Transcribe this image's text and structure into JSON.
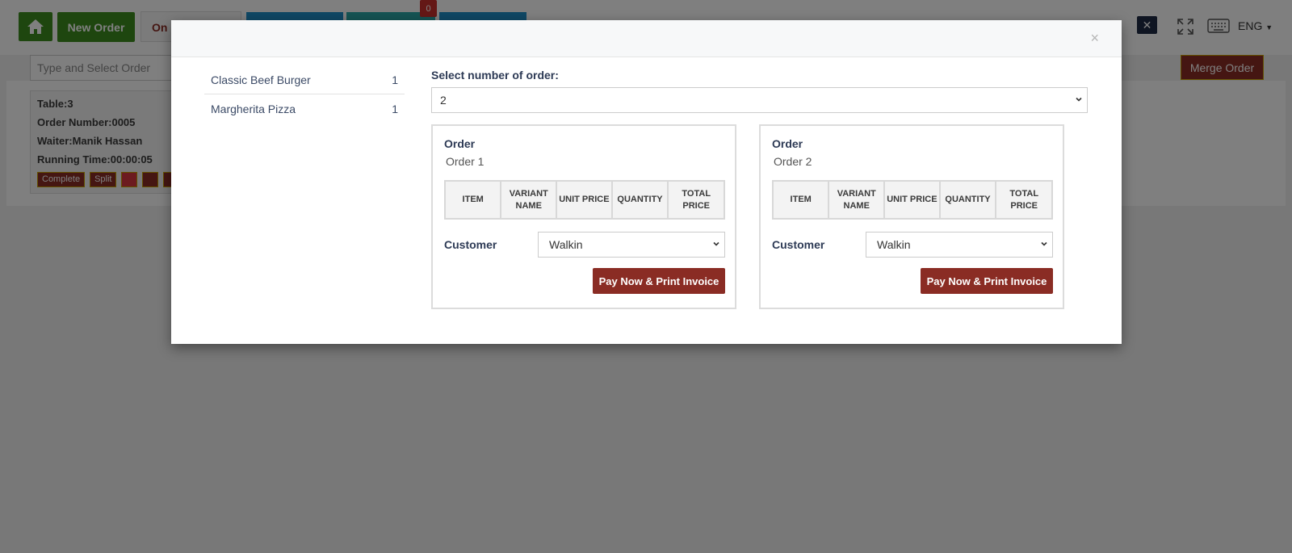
{
  "app": {
    "new_order_label": "New Order",
    "ongoing_label": "On",
    "count_badge": "0",
    "language": "ENG",
    "search_placeholder": "Type and Select Order",
    "merge_label": "Merge Order"
  },
  "order_card": {
    "table": "Table:3",
    "order_number": "Order Number:0005",
    "waiter": "Waiter:Manik Hassan",
    "running_time": "Running Time:00:00:05",
    "complete_label": "Complete",
    "split_label": "Split"
  },
  "modal": {
    "close_glyph": "×",
    "items": [
      {
        "name": "Classic Beef Burger",
        "qty": "1"
      },
      {
        "name": "Margherita Pizza",
        "qty": "1"
      }
    ],
    "select_label": "Select number of order:",
    "selected_count": "2",
    "orders": [
      {
        "title": "Order",
        "subtitle": "Order 1",
        "columns": [
          "ITEM",
          "VARIANT NAME",
          "UNIT PRICE",
          "QUANTITY",
          "TOTAL PRICE"
        ],
        "customer_label": "Customer",
        "customer_value": "Walkin",
        "pay_label": "Pay Now & Print Invoice"
      },
      {
        "title": "Order",
        "subtitle": "Order 2",
        "columns": [
          "ITEM",
          "VARIANT NAME",
          "UNIT PRICE",
          "QUANTITY",
          "TOTAL PRICE"
        ],
        "customer_label": "Customer",
        "customer_value": "Walkin",
        "pay_label": "Pay Now & Print Invoice"
      }
    ]
  },
  "colors": {
    "primary_green": "#3c8d1e",
    "brand_maroon": "#8a2c24",
    "tab_blue": "#1e8ec8",
    "tab_teal": "#2aa6a6",
    "badge_red": "#c9302c"
  }
}
